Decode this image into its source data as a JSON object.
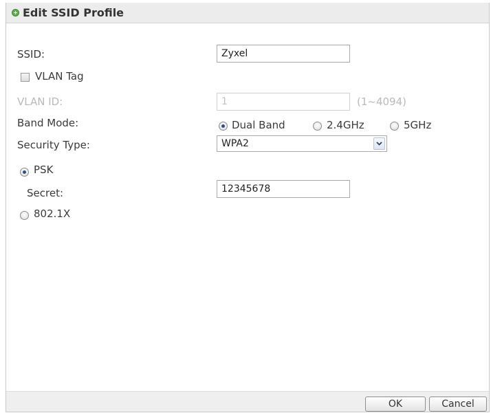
{
  "dialog": {
    "title": "Edit SSID Profile"
  },
  "form": {
    "ssid_label": "SSID:",
    "ssid_value": "Zyxel",
    "vlan_tag_label": "VLAN Tag",
    "vlan_tag_checked": false,
    "vlan_id_label": "VLAN ID:",
    "vlan_id_value": "1",
    "vlan_id_range": "(1~4094)",
    "band_mode_label": "Band Mode:",
    "band_options": [
      "Dual Band",
      "2.4GHz",
      "5GHz"
    ],
    "band_selected": "Dual Band",
    "security_type_label": "Security Type:",
    "security_type_value": "WPA2",
    "psk_label": "PSK",
    "psk_selected": true,
    "secret_label": "Secret:",
    "secret_value": "12345678",
    "dot1x_label": "802.1X",
    "dot1x_selected": false
  },
  "buttons": {
    "ok": "OK",
    "cancel": "Cancel"
  },
  "colors": {
    "header_bg": "#ececec",
    "footer_bg": "#efefef",
    "radio_dot": "#2d4e86",
    "title_icon": "#5ab04a"
  }
}
